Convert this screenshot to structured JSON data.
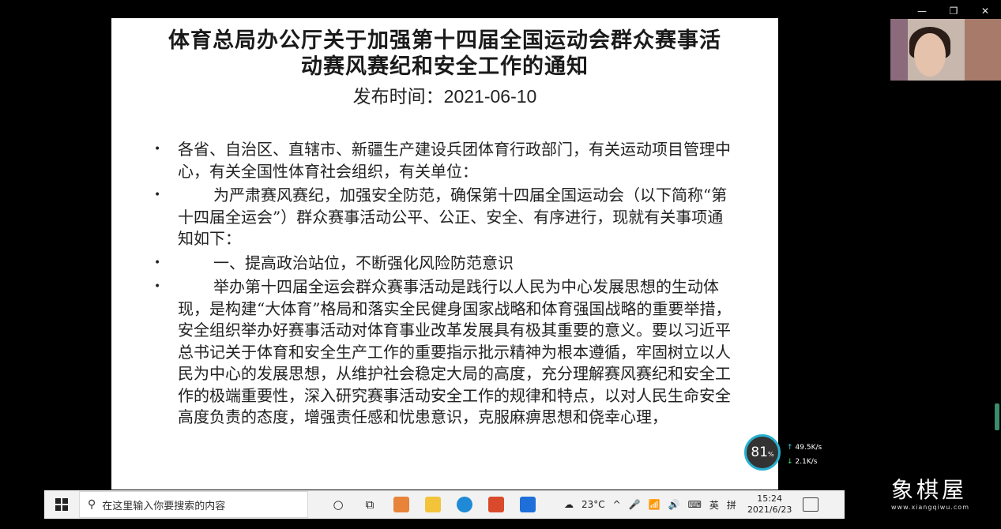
{
  "window": {
    "min_glyph": "—",
    "restore_glyph": "❐",
    "close_glyph": "✕"
  },
  "document": {
    "title_line1": "体育总局办公厅关于加强第十四届全国运动会群众赛事活",
    "title_line2": "动赛风赛纪和安全工作的通知",
    "date_label": "发布时间：",
    "date_value": "2021-06-10",
    "bullet_glyph": "•",
    "paragraphs": [
      "各省、自治区、直辖市、新疆生产建设兵团体育行政部门，有关运动项目管理中心，有关全国性体育社会组织，有关单位：",
      "为严肃赛风赛纪，加强安全防范，确保第十四届全国运动会（以下简称“第十四届全运会”）群众赛事活动公平、公正、安全、有序进行，现就有关事项通知如下：",
      "一、提高政治站位，不断强化风险防范意识",
      "举办第十四届全运会群众赛事活动是践行以人民为中心发展思想的生动体现，是构建“大体育”格局和落实全民健身国家战略和体育强国战略的重要举措，安全组织举办好赛事活动对体育事业改革发展具有极其重要的意义。要以习近平总书记关于体育和安全生产工作的重要指示批示精神为根本遵循，牢固树立以人民为中心的发展思想，从维护社会稳定大局的高度，充分理解赛风赛纪和安全工作的极端重要性，深入研究赛事活动安全工作的规律和特点，以对人民生命安全高度负责的态度，增强责任感和忧患意识，克服麻痹思想和侥幸心理，"
    ]
  },
  "speed_monitor": {
    "percent": "81",
    "percent_unit": "%",
    "upload": "49.5",
    "upload_unit": "K/s",
    "download": "2.1",
    "download_unit": "K/s",
    "upload_arrow": "↑",
    "download_arrow": "↓"
  },
  "taskbar": {
    "search_placeholder": "在这里输入你要搜索的内容",
    "search_glyph": "⚲",
    "taskview_glyph": "○",
    "multitask_glyph": "⧉",
    "apps": [
      {
        "name": "video-player-app",
        "color": "#e8833a"
      },
      {
        "name": "file-explorer-app",
        "color": "#f3c43a"
      },
      {
        "name": "edge-browser-app",
        "color": "#1f8ad6"
      },
      {
        "name": "office-app",
        "color": "#d94a2c"
      },
      {
        "name": "meeting-app",
        "color": "#1e6fd9"
      }
    ],
    "weather_glyph": "☁",
    "temperature": "23°C",
    "tray_chevron": "^",
    "tray_mic": "🎤",
    "tray_wifi": "📶",
    "tray_volume": "🔊",
    "tray_keyboard": "⌨",
    "ime_lang": "英",
    "ime_mode": "拼",
    "time": "15:24",
    "date": "2021/6/23"
  },
  "watermark": {
    "text": "象棋屋",
    "url": "www.xiangqiwu.com"
  }
}
